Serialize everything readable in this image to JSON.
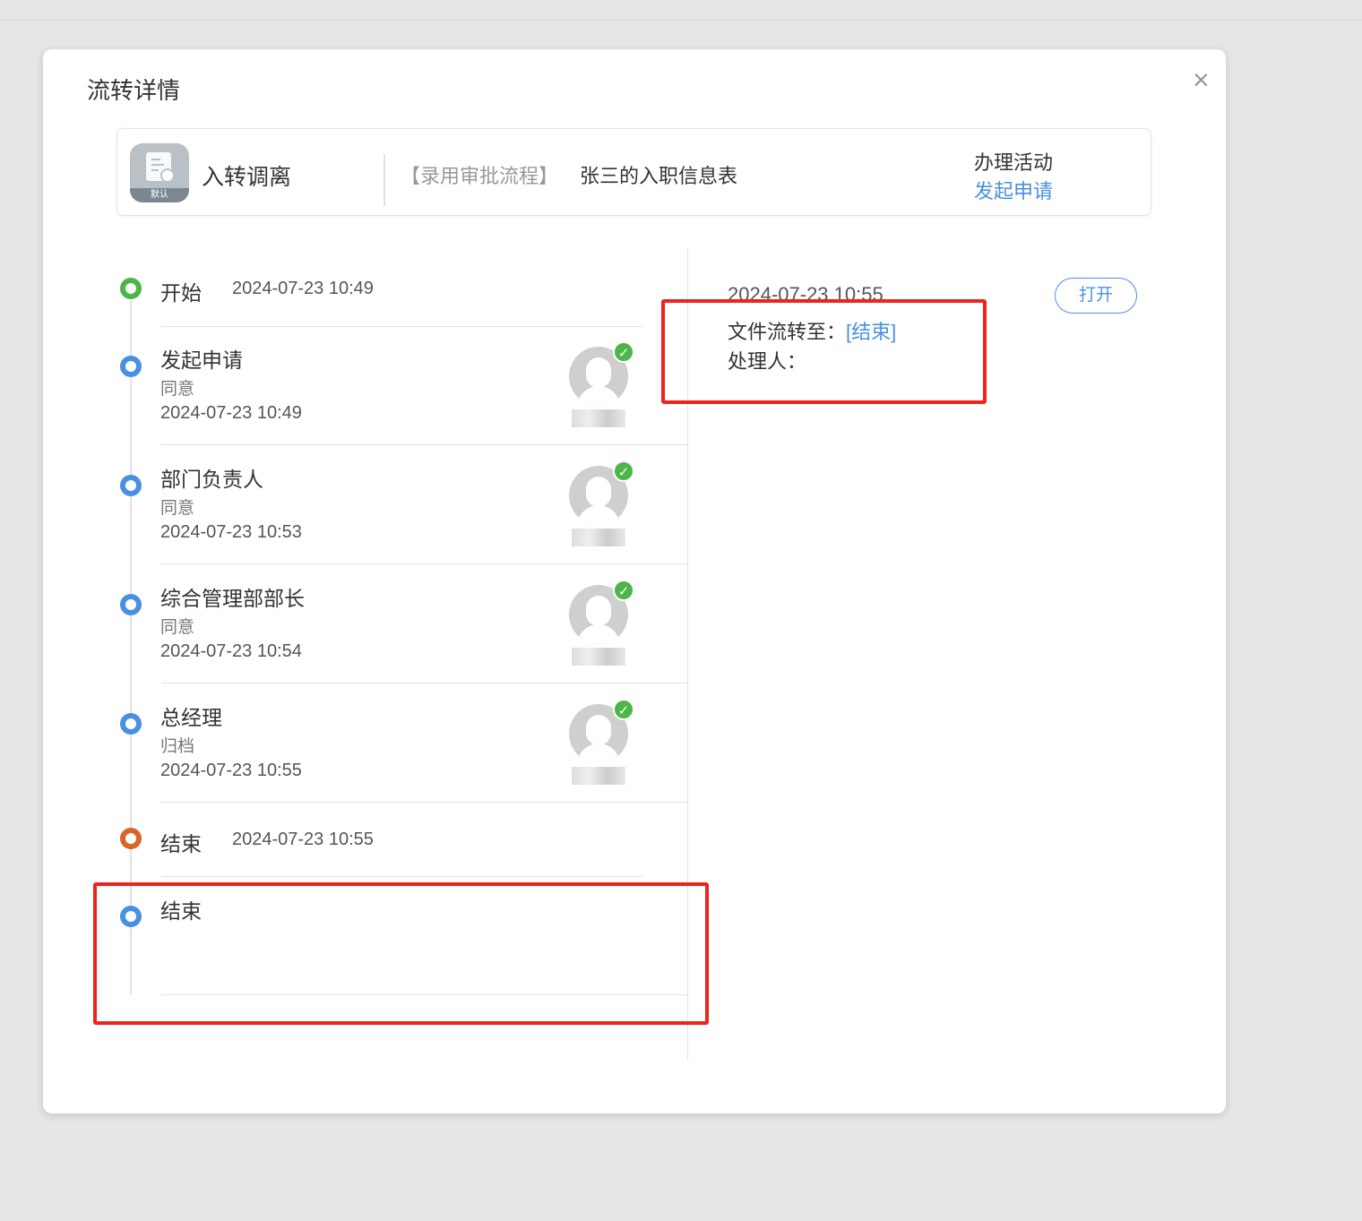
{
  "dialog": {
    "title": "流转详情",
    "close": "×"
  },
  "header": {
    "app_name": "入转调离",
    "app_badge": "默认",
    "process": "【录用审批流程】",
    "form_name": "张三的入职信息表",
    "activity_label": "办理活动",
    "activity_value": "发起申请"
  },
  "timeline": {
    "start": {
      "label": "开始",
      "time": "2024-07-23 10:49"
    },
    "steps": [
      {
        "name": "发起申请",
        "result": "同意",
        "time": "2024-07-23 10:49"
      },
      {
        "name": "部门负责人",
        "result": "同意",
        "time": "2024-07-23 10:53"
      },
      {
        "name": "综合管理部部长",
        "result": "同意",
        "time": "2024-07-23 10:54"
      },
      {
        "name": "总经理",
        "result": "归档",
        "time": "2024-07-23 10:55"
      }
    ],
    "end": {
      "label": "结束",
      "time": "2024-07-23 10:55"
    },
    "extra": {
      "label": "结束"
    }
  },
  "detail": {
    "time": "2024-07-23 10:55",
    "open_button": "打开",
    "transfer_label": "文件流转至：",
    "transfer_value": "[结束]",
    "handler_label": "处理人："
  },
  "colors": {
    "accent": "#4a90e2",
    "green": "#4cb648",
    "orange": "#d9652b",
    "highlight": "#f0231c"
  }
}
